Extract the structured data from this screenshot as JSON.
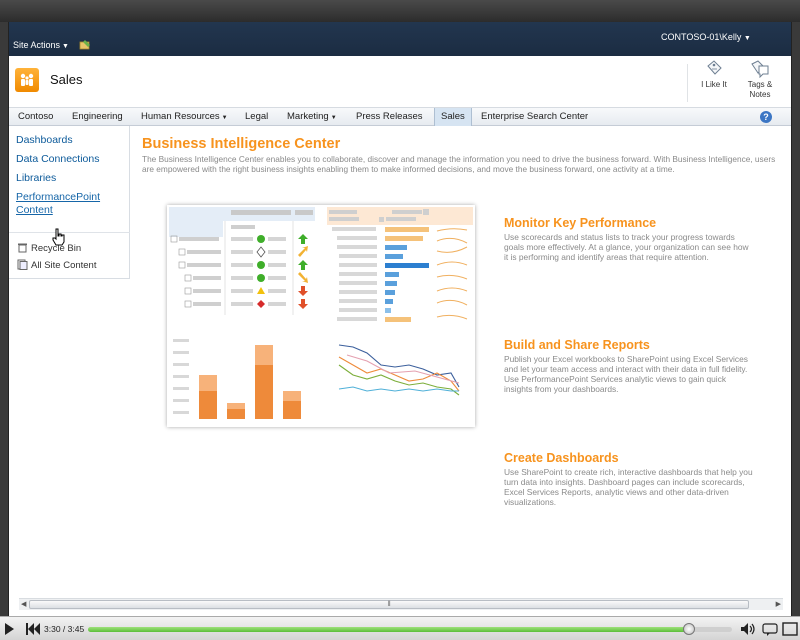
{
  "ribbon": {
    "site_actions": "Site Actions",
    "user": "CONTOSO-01\\Kelly"
  },
  "site": {
    "title": "Sales",
    "like_label": "I Like It",
    "tags_label_1": "Tags &",
    "tags_label_2": "Notes"
  },
  "topnav": {
    "items": [
      {
        "label": "Contoso",
        "dropdown": false
      },
      {
        "label": "Engineering",
        "dropdown": false
      },
      {
        "label": "Human Resources",
        "dropdown": true
      },
      {
        "label": "Legal",
        "dropdown": false
      },
      {
        "label": "Marketing",
        "dropdown": true
      },
      {
        "label": "Press Releases",
        "dropdown": false
      },
      {
        "label": "Sales",
        "dropdown": false,
        "active": true
      },
      {
        "label": "Enterprise Search Center",
        "dropdown": false
      }
    ]
  },
  "quicklaunch": {
    "items": [
      "Dashboards",
      "Data Connections",
      "Libraries",
      "PerformancePoint",
      "Content"
    ],
    "recycle_bin": "Recycle Bin",
    "all_site_content": "All Site Content"
  },
  "main": {
    "title": "Business Intelligence Center",
    "intro": "The Business Intelligence Center enables you to collaborate, discover and manage the information you need to drive the business forward.  With Business Intelligence, users are empowered with the right business insights enabling them to make informed decisions, and move the business forward, one activity at a time.",
    "features": [
      {
        "title": "Monitor Key Performance",
        "desc": "Use scorecards and status lists to track your progress towards goals more effectively. At a glance, your organization can see how it is performing and identify areas that require attention."
      },
      {
        "title": "Build and Share Reports",
        "desc": "Publish your Excel workbooks to SharePoint using Excel Services and let your team access and interact with their data in full fidelity. Use PerformancePoint Services analytic views to gain quick insights from your dashboards."
      },
      {
        "title": "Create Dashboards",
        "desc": "Use SharePoint to create rich, interactive dashboards that help you turn data into insights. Dashboard pages can include scorecards, Excel Services Reports, analytic views and other data-driven visualizations."
      }
    ]
  },
  "player": {
    "time": "3:30 / 3:45",
    "progress": 0.933
  },
  "colors": {
    "accent": "#f7931e",
    "link": "#0c5a9a",
    "ribbon": "#1d2f46"
  }
}
